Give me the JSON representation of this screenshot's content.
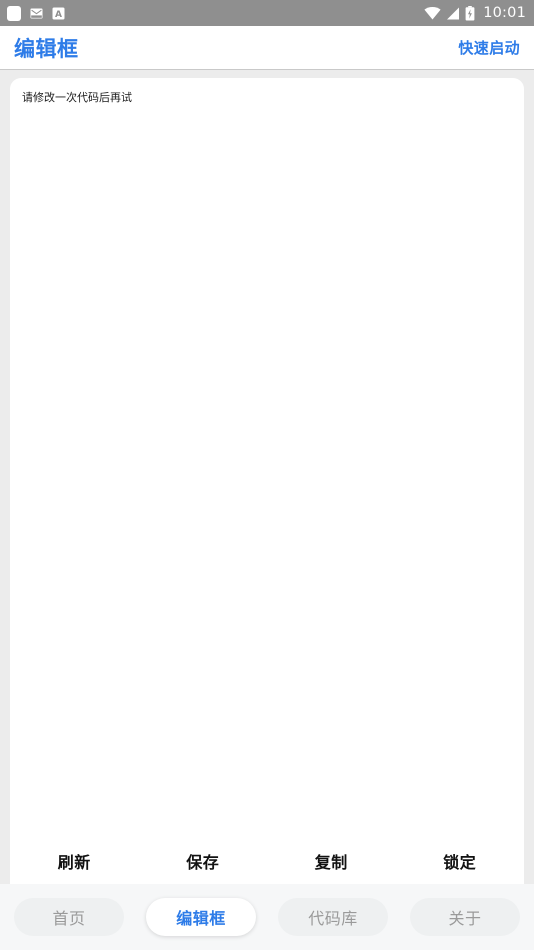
{
  "status_bar": {
    "background": "#8f8f8f",
    "left_icons": [
      {
        "name": "rounded-square-icon"
      },
      {
        "name": "mail-icon"
      },
      {
        "name": "letter-a-icon"
      }
    ],
    "right_icons": [
      {
        "name": "wifi-icon"
      },
      {
        "name": "signal-icon"
      },
      {
        "name": "battery-charging-icon"
      }
    ],
    "time": "10:01"
  },
  "header": {
    "title": "编辑框",
    "action_label": "快速启动",
    "accent_color": "#2e7ce8"
  },
  "editor": {
    "value": "请修改一次代码后再试",
    "placeholder": "请修改一次代码后再试"
  },
  "action_bar": {
    "buttons": [
      {
        "label": "刷新",
        "name": "refresh-button"
      },
      {
        "label": "保存",
        "name": "save-button"
      },
      {
        "label": "复制",
        "name": "copy-button"
      },
      {
        "label": "锁定",
        "name": "lock-button"
      }
    ]
  },
  "tabbar": {
    "tabs": [
      {
        "label": "首页",
        "active": false
      },
      {
        "label": "编辑框",
        "active": true
      },
      {
        "label": "代码库",
        "active": false
      },
      {
        "label": "关于",
        "active": false
      }
    ],
    "active_color": "#2e7ce8",
    "inactive_color": "#9a9a9a"
  }
}
